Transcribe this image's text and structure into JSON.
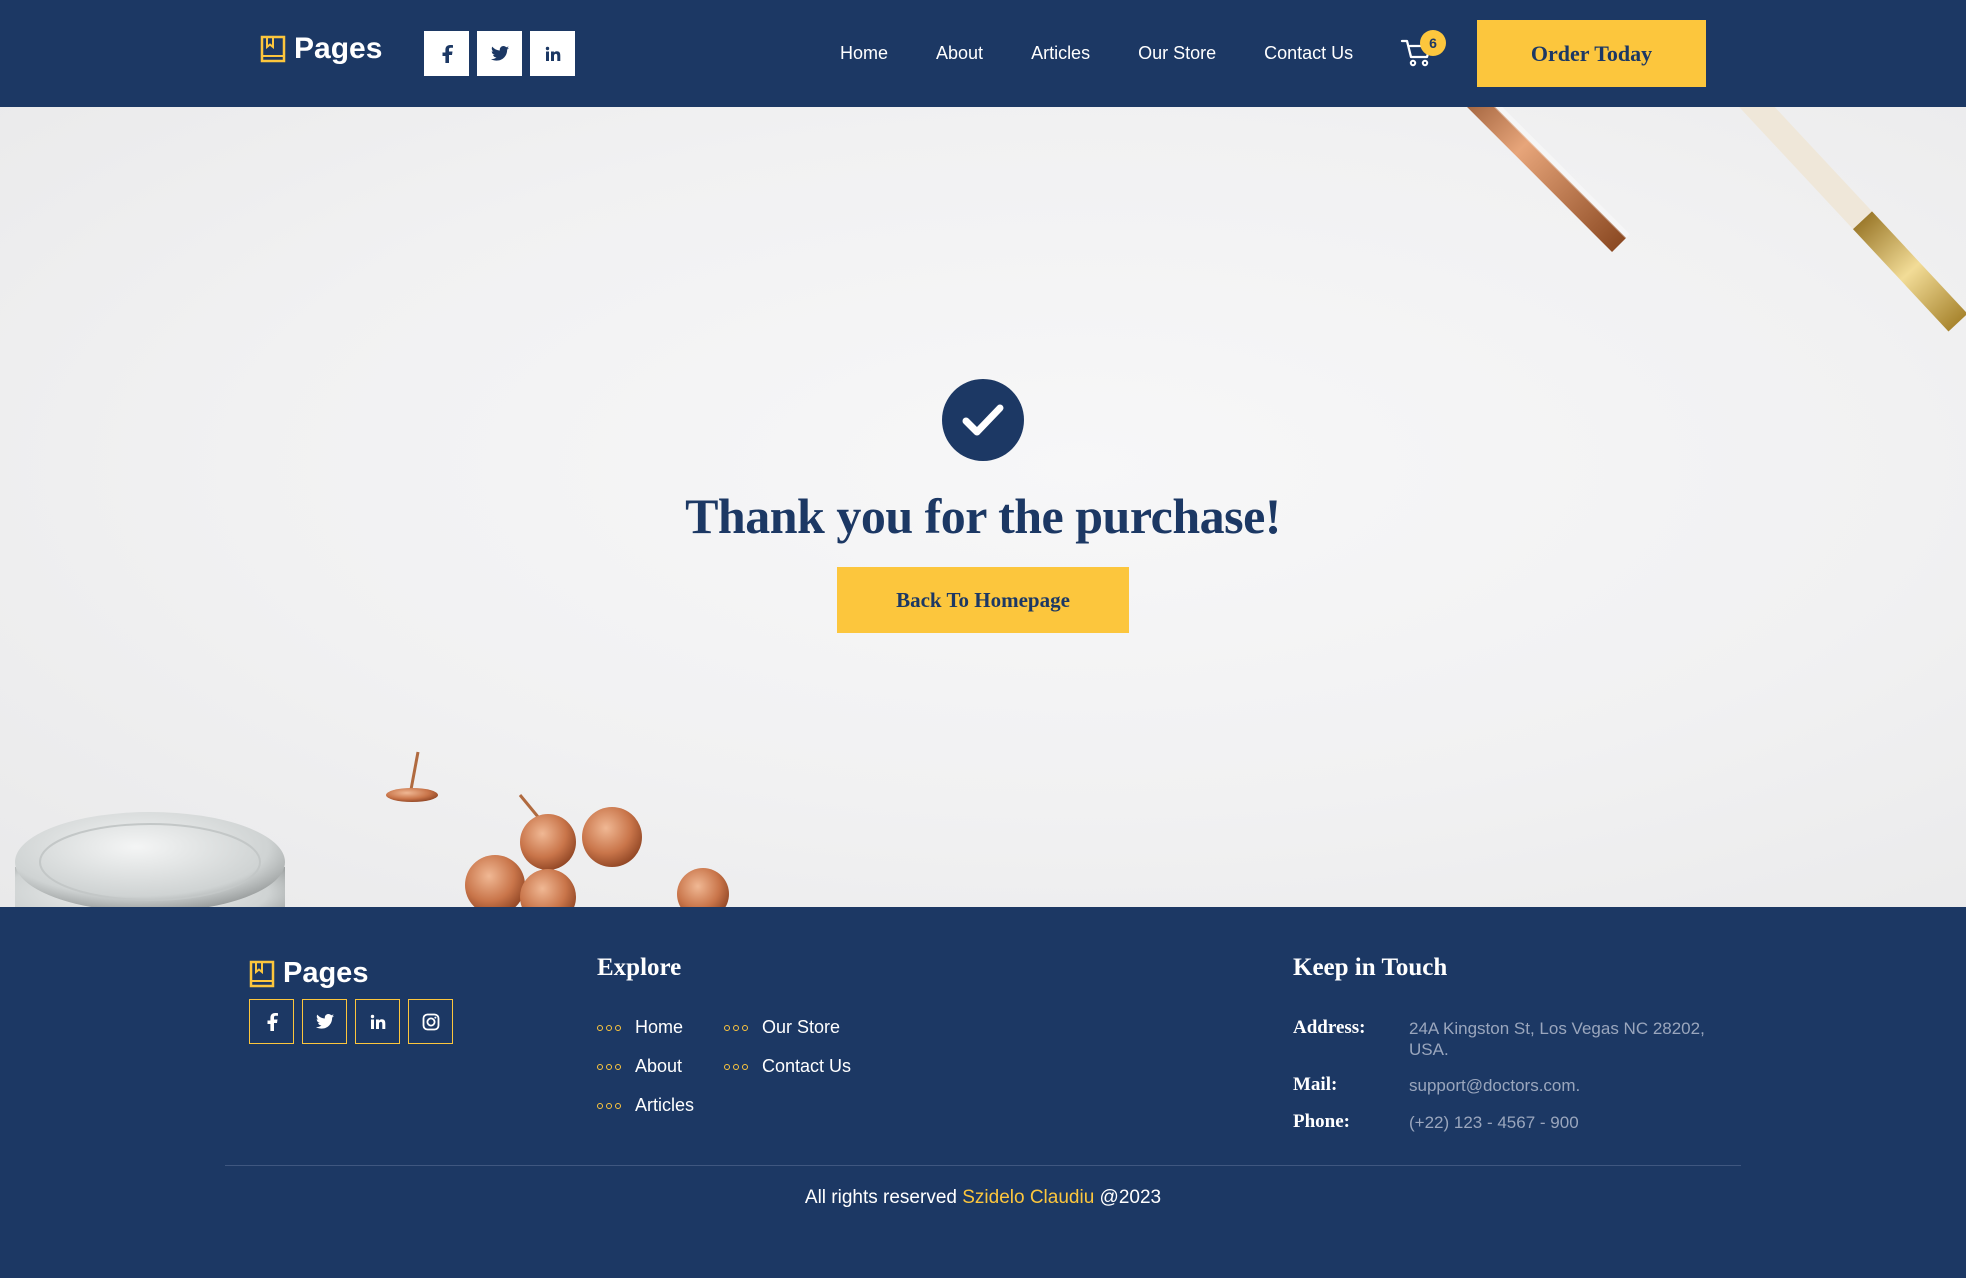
{
  "brand": {
    "name": "Pages",
    "accent": "#fcc63d",
    "primary": "#1c3864"
  },
  "header": {
    "social": [
      {
        "icon": "facebook-icon",
        "glyph": "f"
      },
      {
        "icon": "twitter-icon",
        "glyph": "t"
      },
      {
        "icon": "linkedin-icon",
        "glyph": "in"
      }
    ],
    "nav": [
      "Home",
      "About",
      "Articles",
      "Our Store",
      "Contact Us"
    ],
    "cart_count": "6",
    "order_label": "Order Today"
  },
  "hero": {
    "title": "Thank you for the purchase!",
    "back_label": "Back To Homepage"
  },
  "footer": {
    "brand": "Pages",
    "social": [
      "facebook-icon",
      "twitter-icon",
      "linkedin-icon",
      "instagram-icon"
    ],
    "explore_heading": "Explore",
    "explore_links": {
      "col1": [
        "Home",
        "About",
        "Articles"
      ],
      "col2": [
        "Our Store",
        "Contact Us"
      ]
    },
    "touch_heading": "Keep in Touch",
    "address_label": "Address:",
    "address_value": "24A Kingston St, Los Vegas NC 28202, USA.",
    "mail_label": "Mail:",
    "mail_value": "support@doctors.com.",
    "phone_label": "Phone:",
    "phone_value": "(+22) 123 - 4567 - 900",
    "copyright_prefix": "All rights reserved ",
    "copyright_name": "Szidelo Claudiu",
    "copyright_suffix": " @2023"
  }
}
